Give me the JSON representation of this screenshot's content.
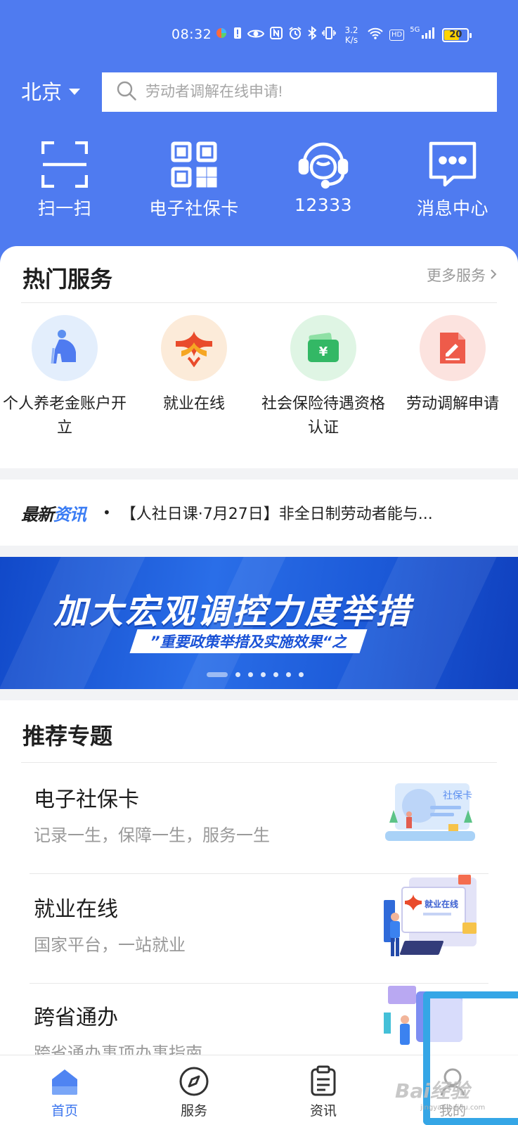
{
  "status_bar": {
    "time": "08:32",
    "net_speed": "3.2\nK/s",
    "hd": "HD",
    "signal_type": "5G",
    "battery": "20"
  },
  "header": {
    "city": "北京",
    "search_placeholder": "劳动者调解在线申请!",
    "quick_actions": [
      {
        "label": "扫一扫",
        "icon": "scan-icon"
      },
      {
        "label": "电子社保卡",
        "icon": "qr-code-icon"
      },
      {
        "label": "12333",
        "icon": "headset-icon"
      },
      {
        "label": "消息中心",
        "icon": "message-icon"
      }
    ]
  },
  "hot_services": {
    "title": "热门服务",
    "more": "更多服务",
    "items": [
      {
        "label": "个人养老金账户开立",
        "icon": "elderly-person-icon",
        "bg": "#e3eefc"
      },
      {
        "label": "就业在线",
        "icon": "employment-logo-icon",
        "bg": "#fcebd9"
      },
      {
        "label": "社会保险待遇资格认证",
        "icon": "wallet-yuan-icon",
        "bg": "#dff5e4"
      },
      {
        "label": "劳动调解申请",
        "icon": "document-pen-icon",
        "bg": "#fce3df"
      }
    ]
  },
  "news": {
    "tag_a": "最新",
    "tag_b": "资讯",
    "headline": "【人社日课·7月27日】非全日制劳动者能与..."
  },
  "banner": {
    "title": "加大宏观调控力度举措",
    "subtitle": "”重要政策举措及实施效果“之",
    "slide_count": 7,
    "active_slide": 1
  },
  "recommended": {
    "title": "推荐专题",
    "items": [
      {
        "title": "电子社保卡",
        "subtitle": "记录一生，保障一生，服务一生",
        "icon": "social-card-illustration",
        "card_text": "社保卡"
      },
      {
        "title": "就业在线",
        "subtitle": "国家平台，一站就业",
        "icon": "employment-online-illustration",
        "card_text": "就业在线"
      },
      {
        "title": "跨省通办",
        "subtitle": "跨省通办事项办事指南",
        "icon": "cross-province-illustration"
      }
    ]
  },
  "tabbar": {
    "tabs": [
      {
        "label": "首页",
        "icon": "home-icon"
      },
      {
        "label": "服务",
        "icon": "compass-icon"
      },
      {
        "label": "资讯",
        "icon": "news-clipboard-icon"
      },
      {
        "label": "我的",
        "icon": "profile-icon"
      }
    ],
    "active": 0
  },
  "watermark": {
    "text": "Bai经验",
    "url_text": "jingyan.baidu.com"
  },
  "colors": {
    "brand_blue": "#4f7bf0",
    "tab_active": "#3b75ee",
    "banner_blue": "#1c5ad8"
  }
}
